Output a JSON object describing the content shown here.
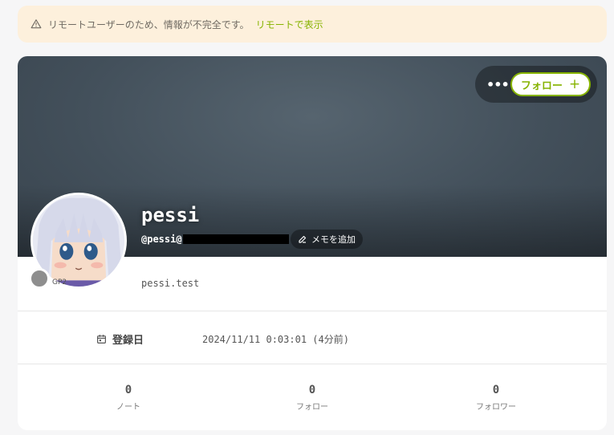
{
  "notice": {
    "message": "リモートユーザーのため、情報が不完全です。",
    "link": "リモートで表示"
  },
  "profile": {
    "display_name": "pessi",
    "acct": "@pessi@",
    "memo_label": "メモを追加",
    "avatar_caption": "GP2",
    "description": "pessi.test",
    "follow_label": "フォロー",
    "more_label": "•••"
  },
  "fields": {
    "joined_label": "登録日",
    "joined_value": "2024/11/11 0:03:01 (4分前)"
  },
  "stats": [
    {
      "value": "0",
      "label": "ノート"
    },
    {
      "value": "0",
      "label": "フォロー"
    },
    {
      "value": "0",
      "label": "フォロワー"
    }
  ],
  "colors": {
    "accent": "#86b300",
    "notice_bg": "#fdf0dc"
  }
}
